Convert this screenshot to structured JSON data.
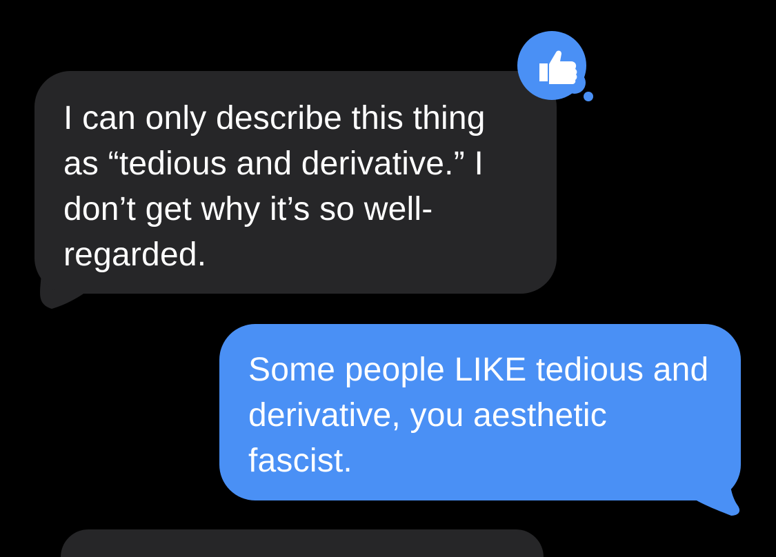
{
  "colors": {
    "background": "#000000",
    "incoming_bubble": "#262628",
    "incoming_text": "#ffffff",
    "outgoing_bubble": "#4a90f5",
    "outgoing_text": "#ffffff",
    "tapback_fill": "#4a90f5",
    "thumb_fill": "#ffffff"
  },
  "messages": [
    {
      "direction": "incoming",
      "text": "I can only describe this thing as “tedious and derivative.” I don’t get why it’s so well-regarded.",
      "tapback": {
        "icon": "thumbs-up-icon",
        "meaning": "liked"
      }
    },
    {
      "direction": "outgoing",
      "text": "Some people LIKE tedious and derivative, you aesthetic fascist."
    }
  ]
}
